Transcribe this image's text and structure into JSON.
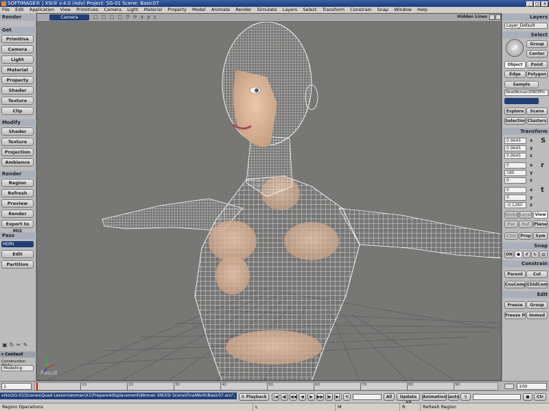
{
  "titlebar": {
    "title": "SOFTIMAGE® | XSI® v.4.0 (Adv) Project: SG-01    Scene: Basic07",
    "buttons": [
      "_",
      "□",
      "x"
    ]
  },
  "menubar": [
    "File",
    "Edit",
    "Application",
    "View",
    "Primitives",
    "Camera",
    "Light",
    "Material",
    "Property",
    "Model",
    "Animate",
    "Render",
    "Simulate",
    "Layers",
    "Select",
    "Transform",
    "Constrain",
    "Snap",
    "Window",
    "Help"
  ],
  "left_panel": {
    "header": "Render",
    "get": {
      "title": "Get",
      "buttons": [
        "Primitive",
        "Camera",
        "Light",
        "Material",
        "Property",
        "Shader",
        "Texture",
        "Clip"
      ]
    },
    "modify": {
      "title": "Modify",
      "buttons": [
        "Shader",
        "Texture",
        "Projection",
        "Ambience"
      ]
    },
    "render": {
      "title": "Render",
      "buttons": [
        "Region",
        "Refresh",
        "Preview",
        "Render",
        "Export to MI2"
      ]
    },
    "pass": {
      "title": "Pass",
      "selected": "HDRI",
      "buttons": [
        "Edit",
        "Partition"
      ]
    },
    "context": {
      "title": "Context",
      "mode_label": "Construction Mode",
      "mode_value": "Modeling"
    },
    "tool_icons": [
      "snapshot-icon",
      "rotate-icon",
      "scissors-icon",
      "paint-icon"
    ]
  },
  "viewport": {
    "camera": "Camera",
    "display_mode": "Hidden Lines",
    "header_icons": [
      "□",
      "□",
      "□",
      "□",
      "⚲",
      "⟳",
      "x",
      "y",
      "z"
    ],
    "label": "Result",
    "colors": {
      "background": "#777776",
      "wire": "#ffffff",
      "skin": "#e2bc9a",
      "grid": "#5e5e5e"
    }
  },
  "right_panel": {
    "layers": {
      "title": "Layers",
      "layer": "Layer_Default"
    },
    "select": {
      "title": "Select",
      "buttons": [
        "Group",
        "Center",
        "Object",
        "Point",
        "Edge",
        "Polygon",
        "Sample"
      ],
      "object_name": "NewWoman\\XN03Fin",
      "nav": [
        "Explore",
        "Scene",
        "Selection",
        "Clusters"
      ]
    },
    "transform": {
      "title": "Transform",
      "scale": [
        "0.9645",
        "0.9645",
        "0.9645"
      ],
      "rotate": [
        "0",
        "180",
        "0"
      ],
      "translate": [
        "0",
        "0",
        "-0.1280"
      ],
      "axes": [
        "x",
        "y",
        "z"
      ],
      "modes": [
        "Global",
        "Local",
        "View",
        "Par",
        "Ref",
        "Plane",
        "COG",
        "Prop",
        "Sym"
      ]
    },
    "snap": {
      "title": "Snap",
      "on": "ON"
    },
    "constrain": {
      "title": "Constrain",
      "buttons": [
        "Parent",
        "Cut",
        "CnsComp",
        "ChldComp"
      ]
    },
    "edit": {
      "title": "Edit",
      "buttons": [
        "Freeze",
        "Group",
        "Freeze M",
        "Immed"
      ]
    }
  },
  "timeline": {
    "start": "1",
    "end": "100",
    "ticks": [
      "10",
      "20",
      "30",
      "40",
      "50",
      "60",
      "70",
      "80",
      "90"
    ]
  },
  "command_bar": {
    "command": "orks\\SG-01\\Scenes\\Quad Lesson\\woman\\X1\\Prepare4displacement\\Woman XN\\XSI Scene\\FinalWork\\Basic07.scn\", False",
    "playback": "Playback",
    "transport": [
      "|◀",
      "◀|",
      "◀◀",
      "◀",
      "▶",
      "▶▶",
      "|▶",
      "▶|",
      "⟲"
    ],
    "all_label": "All",
    "update_all": "Update All",
    "animation": "Animation",
    "auto": "auto",
    "ctr": "Ctr"
  },
  "statusbar": {
    "left": "Region Operations",
    "l": "L",
    "m": "M",
    "r": "R",
    "right": "Refresh Region"
  }
}
